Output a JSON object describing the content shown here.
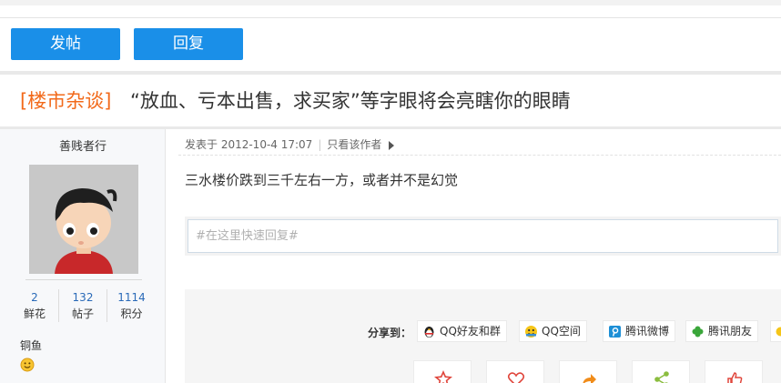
{
  "toolbar": {
    "post_label": "发帖",
    "reply_label": "回复"
  },
  "thread": {
    "category": "[楼市杂谈]",
    "title": "“放血、亏本出售，求买家”等字眼将会亮瞎你的眼睛"
  },
  "author": {
    "name": "善贱者行",
    "stats": [
      {
        "value": "2",
        "label": "鲜花"
      },
      {
        "value": "132",
        "label": "帖子"
      },
      {
        "value": "1114",
        "label": "积分"
      }
    ],
    "rank": "铜鱼"
  },
  "post": {
    "posted_at": "发表于 2012-10-4 17:07",
    "only_author": "只看该作者",
    "content": "三水楼价跌到三千左右一方，或者并不是幻觉"
  },
  "quick_reply": {
    "placeholder": "#在这里快速回复#"
  },
  "share": {
    "label": "分享到：",
    "items": [
      "QQ好友和群",
      "QQ空间",
      "腾讯微博",
      "腾讯朋友"
    ]
  },
  "colors": {
    "accent": "#1a8fe8",
    "category": "#f26a1b",
    "link": "#2a6ab8"
  }
}
